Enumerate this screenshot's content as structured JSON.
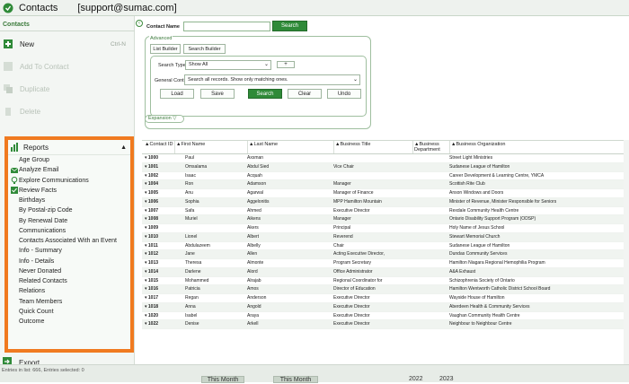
{
  "window": {
    "title": "Contacts",
    "account": "[support@sumac.com]"
  },
  "sidebar": {
    "section_title": "Contacts",
    "actions": [
      {
        "label": "New",
        "shortcut": "Ctrl-N",
        "enabled": true,
        "icon": "new-icon"
      },
      {
        "label": "Add To Contact",
        "enabled": false,
        "icon": "add-icon"
      },
      {
        "label": "Duplicate",
        "enabled": false,
        "icon": "duplicate-icon"
      },
      {
        "label": "Delete",
        "enabled": false,
        "icon": "delete-icon"
      }
    ],
    "reports_label": "Reports",
    "report_items": [
      "Age Group",
      "Analyze Email",
      "Explore Communications",
      "Review Facts",
      "Birthdays",
      "By Postal-zip Code",
      "By Renewal Date",
      "Communications",
      "Contacts Associated With an Event",
      "Info - Summary",
      "Info - Details",
      "Never Donated",
      "Related Contacts",
      "Relations",
      "Team Members",
      "Quick Count",
      "Outcome"
    ],
    "export_label": "Export",
    "highlight_color": "#f07a20"
  },
  "search": {
    "contact_name_label": "Contact Name",
    "contact_name_value": "",
    "search_button": "Search",
    "advanced_label": "Advanced",
    "list_builder": "List Builder",
    "search_builder": "Search Builder",
    "search_type_label": "Search Type:",
    "search_type_value": "Show All",
    "plus_label": "+",
    "general_control_label": "General Control:",
    "general_control_value": "Search all records. Show only matching ones.",
    "buttons": {
      "load": "Load",
      "save": "Save",
      "search": "Search",
      "clear": "Clear",
      "undo": "Undo"
    },
    "expansion_label": "Expansion"
  },
  "grid": {
    "columns": [
      "Contact ID",
      "First Name",
      "Last Name",
      "Business Title",
      "Business Department",
      "Business Organization"
    ],
    "rows": [
      [
        "1000",
        "Paul",
        "Axsman",
        "",
        "",
        "Street Light Ministries"
      ],
      [
        "1001",
        "Omsalama",
        "Abdul Sied",
        "Vice Chair",
        "",
        "Sudanese League of Hamilton"
      ],
      [
        "1002",
        "Isaac",
        "Acquah",
        "",
        "",
        "Career Development & Learning Centre, YMCA"
      ],
      [
        "1004",
        "Ron",
        "Adamson",
        "Manager",
        "",
        "Scottish Rite Club"
      ],
      [
        "1005",
        "Anu",
        "Agarwal",
        "Manager of Finance",
        "",
        "Anson Windows and Doors"
      ],
      [
        "1006",
        "Sophia",
        "Aggelonitis",
        "MPP Hamilton Mountain",
        "",
        "Minister of Revenue, Minister Responsible for Seniors"
      ],
      [
        "1007",
        "Safa",
        "Ahmed",
        "Executive Director",
        "",
        "Rexdale Community Health Centre"
      ],
      [
        "1008",
        "Muriel",
        "Aikens",
        "Manager",
        "",
        "Ontario Disability Support Program (ODSP)"
      ],
      [
        "1009",
        "",
        "Akers",
        "Principal",
        "",
        "Holy Name of Jesus School"
      ],
      [
        "1010",
        "Lionel",
        "Albert",
        "Reverend",
        "",
        "Stewart Memorial Church"
      ],
      [
        "1011",
        "Abdulazeem",
        "Albelly",
        "Chair",
        "",
        "Sudanese League of Hamilton"
      ],
      [
        "1012",
        "Jane",
        "Allen",
        "Acting Executive Director,",
        "",
        "Dundas Community Services"
      ],
      [
        "1013",
        "Theresa",
        "Almonte",
        "Program Secretary",
        "",
        "Hamilton Niagara Regional Hemophilia Program"
      ],
      [
        "1014",
        "Darlene",
        "Alord",
        "Office Administrator",
        "",
        "A&A Exhaust"
      ],
      [
        "1015",
        "Mohammed",
        "Alrajab",
        "Regional Coordinator for",
        "",
        "Schizophrenia Society of Ontario"
      ],
      [
        "1016",
        "Patricia",
        "Amos",
        "Director of Education",
        "",
        "Hamilton Wentworth Catholic District School Board"
      ],
      [
        "1017",
        "Regan",
        "Anderson",
        "Executive Director",
        "",
        "Wayside House of Hamilton"
      ],
      [
        "1018",
        "Anna",
        "Angold",
        "Executive Director",
        "",
        "Aberdeen Health & Community Services"
      ],
      [
        "1020",
        "Isabel",
        "Araya",
        "Executive Director",
        "",
        "Vaughan Community Health Centre"
      ],
      [
        "1022",
        "Denise",
        "Arkell",
        "Executive Director",
        "",
        "Neighbour to Neighbour Centre"
      ]
    ]
  },
  "status": {
    "entries": "Entries in list: 666, Entries selected: 0",
    "tabs": [
      "This Month",
      "This Month"
    ],
    "years": [
      "2022",
      "2023"
    ]
  }
}
